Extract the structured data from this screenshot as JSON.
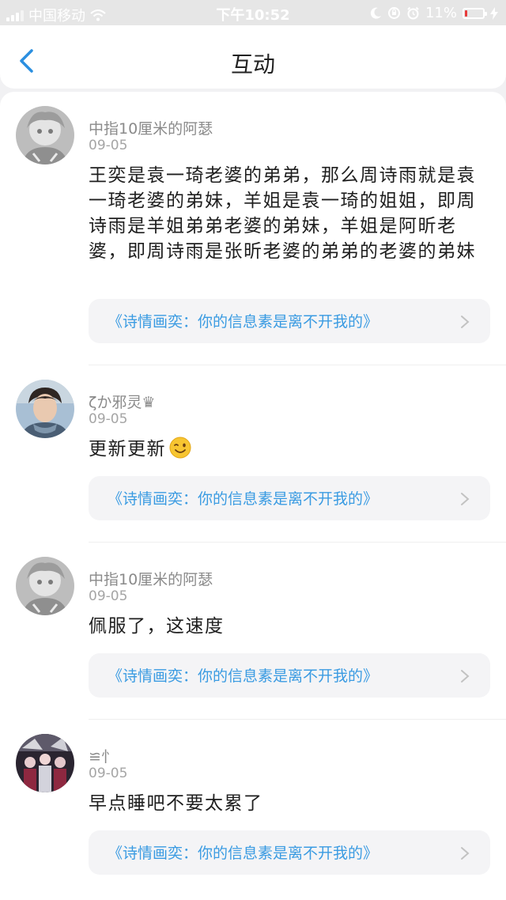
{
  "status_bar": {
    "carrier": "中国移动",
    "time": "下午10:52",
    "battery_text": "11%",
    "battery_color": "#e83b3b"
  },
  "nav": {
    "title": "互动"
  },
  "comments": [
    {
      "username": "中指10厘米的阿瑟",
      "date": "09-05",
      "text": "王奕是袁一琦老婆的弟弟，那么周诗雨就是袁一琦老婆的弟妹，羊姐是袁一琦的姐姐，即周诗雨是羊姐弟弟老婆的弟妹，羊姐是阿昕老婆，即周诗雨是张昕老婆的弟弟的老婆的弟妹",
      "link": "《诗情画奕：你的信息素是离不开我的》"
    },
    {
      "username": "ζか邪灵♛",
      "date": "09-05",
      "text": "更新更新",
      "emoji": "winking-face",
      "link": "《诗情画奕：你的信息素是离不开我的》"
    },
    {
      "username": "中指10厘米的阿瑟",
      "date": "09-05",
      "text": "佩服了，这速度",
      "link": "《诗情画奕：你的信息素是离不开我的》"
    },
    {
      "username": "≌忄",
      "date": "09-05",
      "text": "早点睡吧不要太累了",
      "link": "《诗情画奕：你的信息素是离不开我的》"
    }
  ],
  "colors": {
    "link": "#3a9be2",
    "accent": "#2b8fe0"
  }
}
